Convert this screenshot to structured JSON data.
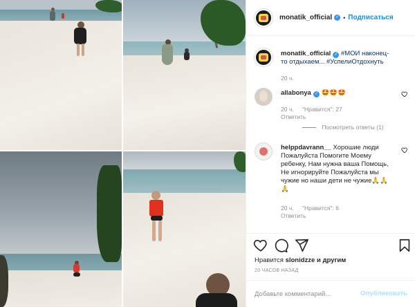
{
  "post": {
    "username": "monatik_official",
    "follow_label": "Подписаться",
    "separator": "•"
  },
  "caption": {
    "username": "monatik_official",
    "text": "#МОИ наконец-то отдыхаем... #УспелиОтдохнуть",
    "time": "20 ч."
  },
  "comments": [
    {
      "username": "allabonya",
      "text": "🤩🤩🤩",
      "time": "20 ч.",
      "likes": "\"Нравится\": 27",
      "reply": "Ответить",
      "view_replies": "Посмотреть ответы (1)"
    },
    {
      "username": "helppdavrann__",
      "text": "Хорошие люди Пожалуйста Помогите Моему ребенку, Нам нужна ваша Помощь, Не игнорируйте Пожалуйста мы чужие но наши дети не чужие🙏🙏🙏",
      "time": "20 ч.",
      "likes": "\"Нравится\": 6",
      "reply": "Ответить"
    }
  ],
  "actions": {
    "liked_by_prefix": "Нравится",
    "liked_by_user": "slonidzze",
    "liked_by_suffix": "и другим",
    "timestamp": "20 ЧАСОВ НАЗАД"
  },
  "comment_box": {
    "placeholder": "Добавьте комментарий...",
    "publish_label": "Опубликовать"
  },
  "icons": [
    "heart-icon",
    "comment-icon",
    "share-icon",
    "bookmark-icon",
    "verified-icon",
    "small-heart-icon"
  ],
  "colors": {
    "link": "#0095f6",
    "verified": "#3897f0",
    "muted": "#8e8e8e",
    "publish_disabled": "#b2dffc"
  }
}
